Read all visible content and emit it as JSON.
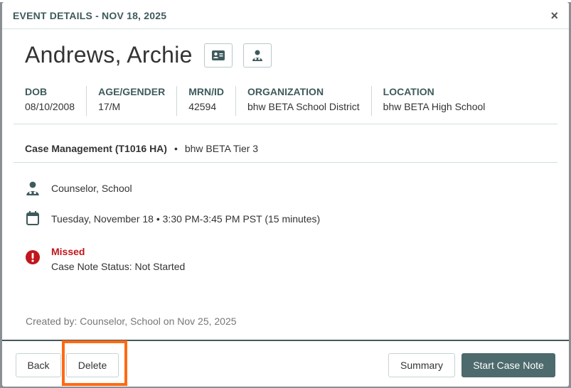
{
  "modal": {
    "title": "EVENT DETAILS - NOV 18, 2025",
    "close_label": "×"
  },
  "patient": {
    "name": "Andrews, Archie",
    "icons": [
      "id-card-icon",
      "provider-icon"
    ]
  },
  "info": [
    {
      "label": "DOB",
      "value": "08/10/2008"
    },
    {
      "label": "AGE/GENDER",
      "value": "17/M"
    },
    {
      "label": "MRN/ID",
      "value": "42594"
    },
    {
      "label": "ORGANIZATION",
      "value": "bhw BETA School District"
    },
    {
      "label": "LOCATION",
      "value": "bhw BETA High School"
    }
  ],
  "service": {
    "name": "Case Management (T1016 HA)",
    "separator": "•",
    "tier": "bhw BETA Tier 3"
  },
  "details": {
    "provider": "Counselor, School",
    "datetime": "Tuesday, November 18 • 3:30 PM-3:45 PM PST (15 minutes)",
    "status_title": "Missed",
    "case_note_status": "Case Note Status: Not Started"
  },
  "created_by": "Created by: Counselor, School on Nov 25, 2025",
  "footer": {
    "back_label": "Back",
    "delete_label": "Delete",
    "summary_label": "Summary",
    "start_case_note_label": "Start Case Note"
  },
  "colors": {
    "accent": "#4d6a6c",
    "error": "#c0161c",
    "highlight": "#ff6a13"
  }
}
